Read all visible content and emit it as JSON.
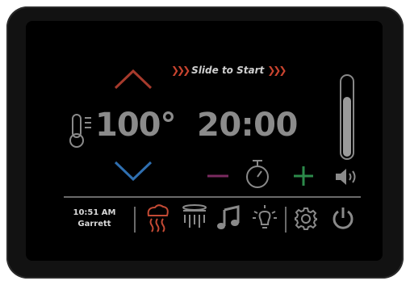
{
  "header": {
    "slide_text": "Slide to Start"
  },
  "controls": {
    "temperature": "100°",
    "timer": "20:00"
  },
  "status": {
    "time": "10:51 AM",
    "user": "Garrett"
  },
  "icons": {
    "temp_up": "chevron-up-icon",
    "temp_down": "chevron-down-icon",
    "thermometer": "thermometer-icon",
    "timer_minus": "minus-icon",
    "timer_plus": "plus-icon",
    "stopwatch": "stopwatch-icon",
    "volume": "speaker-icon",
    "steam": "steam-icon",
    "shower": "shower-icon",
    "music": "music-icon",
    "light": "light-bulb-icon",
    "settings": "gear-icon",
    "power": "power-icon"
  },
  "colors": {
    "up_arrow": "#a63a2c",
    "down_arrow": "#2f6fb0",
    "minus": "#7a2a5f",
    "plus": "#2c8a4a",
    "steam_active": "#c44a34",
    "icon_gray": "#8a8a8a",
    "text_gray": "#8b8b8b"
  }
}
